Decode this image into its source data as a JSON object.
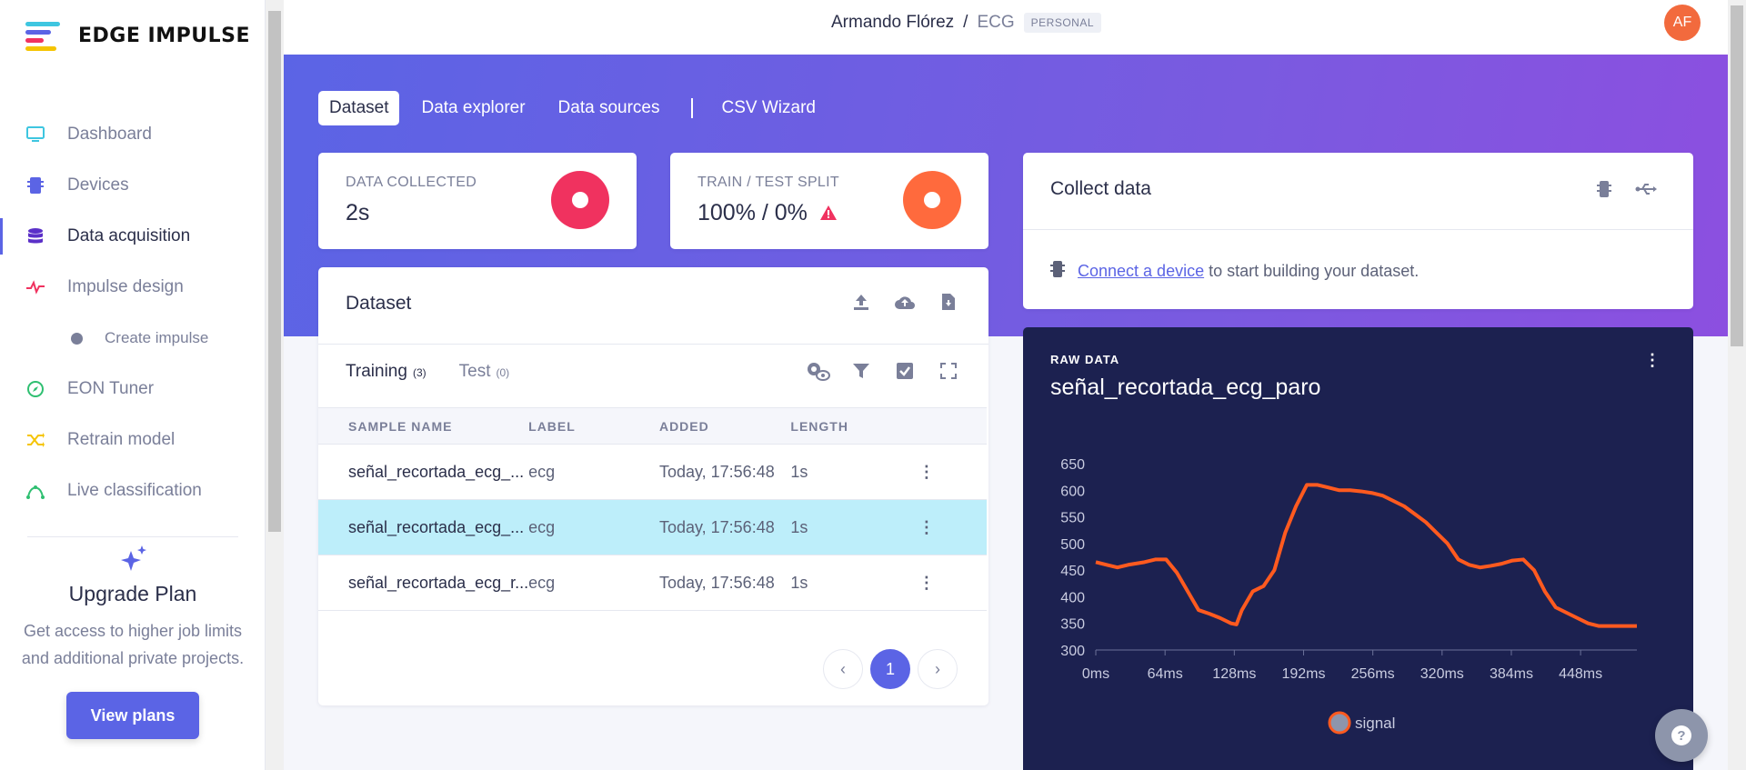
{
  "app": {
    "logo_text": "EDGE IMPULSE"
  },
  "sidebar": {
    "items": [
      {
        "label": "Dashboard",
        "icon": "monitor-icon"
      },
      {
        "label": "Devices",
        "icon": "chip-icon"
      },
      {
        "label": "Data acquisition",
        "icon": "database-icon",
        "active": true
      },
      {
        "label": "Impulse design",
        "icon": "pulse-icon"
      },
      {
        "label": "Create impulse",
        "icon": "dot-icon",
        "sub": true
      },
      {
        "label": "EON Tuner",
        "icon": "compass-icon"
      },
      {
        "label": "Retrain model",
        "icon": "shuffle-icon"
      },
      {
        "label": "Live classification",
        "icon": "curve-icon"
      }
    ],
    "upgrade": {
      "title": "Upgrade Plan",
      "description": "Get access to higher job limits and additional private projects.",
      "button": "View plans"
    }
  },
  "topbar": {
    "owner": "Armando Flórez",
    "separator": "/",
    "project": "ECG",
    "badge": "PERSONAL",
    "avatar": "AF"
  },
  "tabs": [
    "Dataset",
    "Data explorer",
    "Data sources",
    "CSV Wizard"
  ],
  "stats": {
    "collected_label": "DATA COLLECTED",
    "collected_value": "2s",
    "split_label": "TRAIN / TEST SPLIT",
    "split_value": "100% / 0%"
  },
  "dataset": {
    "title": "Dataset",
    "subtabs": [
      {
        "label": "Training",
        "count": "(3)"
      },
      {
        "label": "Test",
        "count": "(0)"
      }
    ],
    "columns": [
      "SAMPLE NAME",
      "LABEL",
      "ADDED",
      "LENGTH"
    ],
    "rows": [
      {
        "name": "señal_recortada_ecg_...",
        "label": "ecg",
        "added": "Today, 17:56:48",
        "length": "1s"
      },
      {
        "name": "señal_recortada_ecg_...",
        "label": "ecg",
        "added": "Today, 17:56:48",
        "length": "1s",
        "selected": true
      },
      {
        "name": "señal_recortada_ecg_r...",
        "label": "ecg",
        "added": "Today, 17:56:48",
        "length": "1s"
      }
    ],
    "page": "1"
  },
  "collect": {
    "title": "Collect data",
    "link": "Connect a device",
    "text": " to start building your dataset."
  },
  "raw": {
    "label": "RAW DATA",
    "title": "señal_recortada_ecg_paro"
  },
  "colors": {
    "accent": "#5b64e5",
    "donut_collected": "#f0325f",
    "donut_split": "#ff6a3d",
    "signal": "#ff5a1f",
    "warning": "#f0325f"
  },
  "chart_data": {
    "type": "line",
    "x_ticks": [
      "0ms",
      "64ms",
      "128ms",
      "192ms",
      "256ms",
      "320ms",
      "384ms",
      "448ms"
    ],
    "y_ticks": [
      "650",
      "600",
      "550",
      "500",
      "450",
      "400",
      "350",
      "300"
    ],
    "ylim": [
      300,
      650
    ],
    "xlim": [
      0,
      500
    ],
    "series": [
      {
        "name": "signal",
        "x": [
          0,
          10,
          20,
          30,
          45,
          55,
          65,
          75,
          85,
          95,
          105,
          115,
          125,
          130,
          135,
          145,
          155,
          165,
          175,
          185,
          195,
          205,
          215,
          225,
          235,
          245,
          255,
          265,
          275,
          285,
          295,
          305,
          315,
          325,
          335,
          345,
          355,
          365,
          375,
          385,
          395,
          405,
          415,
          425,
          435,
          445,
          455,
          465,
          475,
          485,
          495,
          500
        ],
        "y": [
          465,
          460,
          455,
          460,
          465,
          470,
          470,
          445,
          410,
          375,
          368,
          360,
          350,
          348,
          375,
          410,
          420,
          450,
          520,
          570,
          610,
          610,
          605,
          600,
          600,
          598,
          595,
          590,
          580,
          570,
          555,
          540,
          520,
          500,
          470,
          460,
          455,
          458,
          462,
          468,
          470,
          450,
          410,
          380,
          370,
          360,
          350,
          345,
          345,
          345,
          345,
          345
        ]
      }
    ],
    "legend": "bottom"
  }
}
